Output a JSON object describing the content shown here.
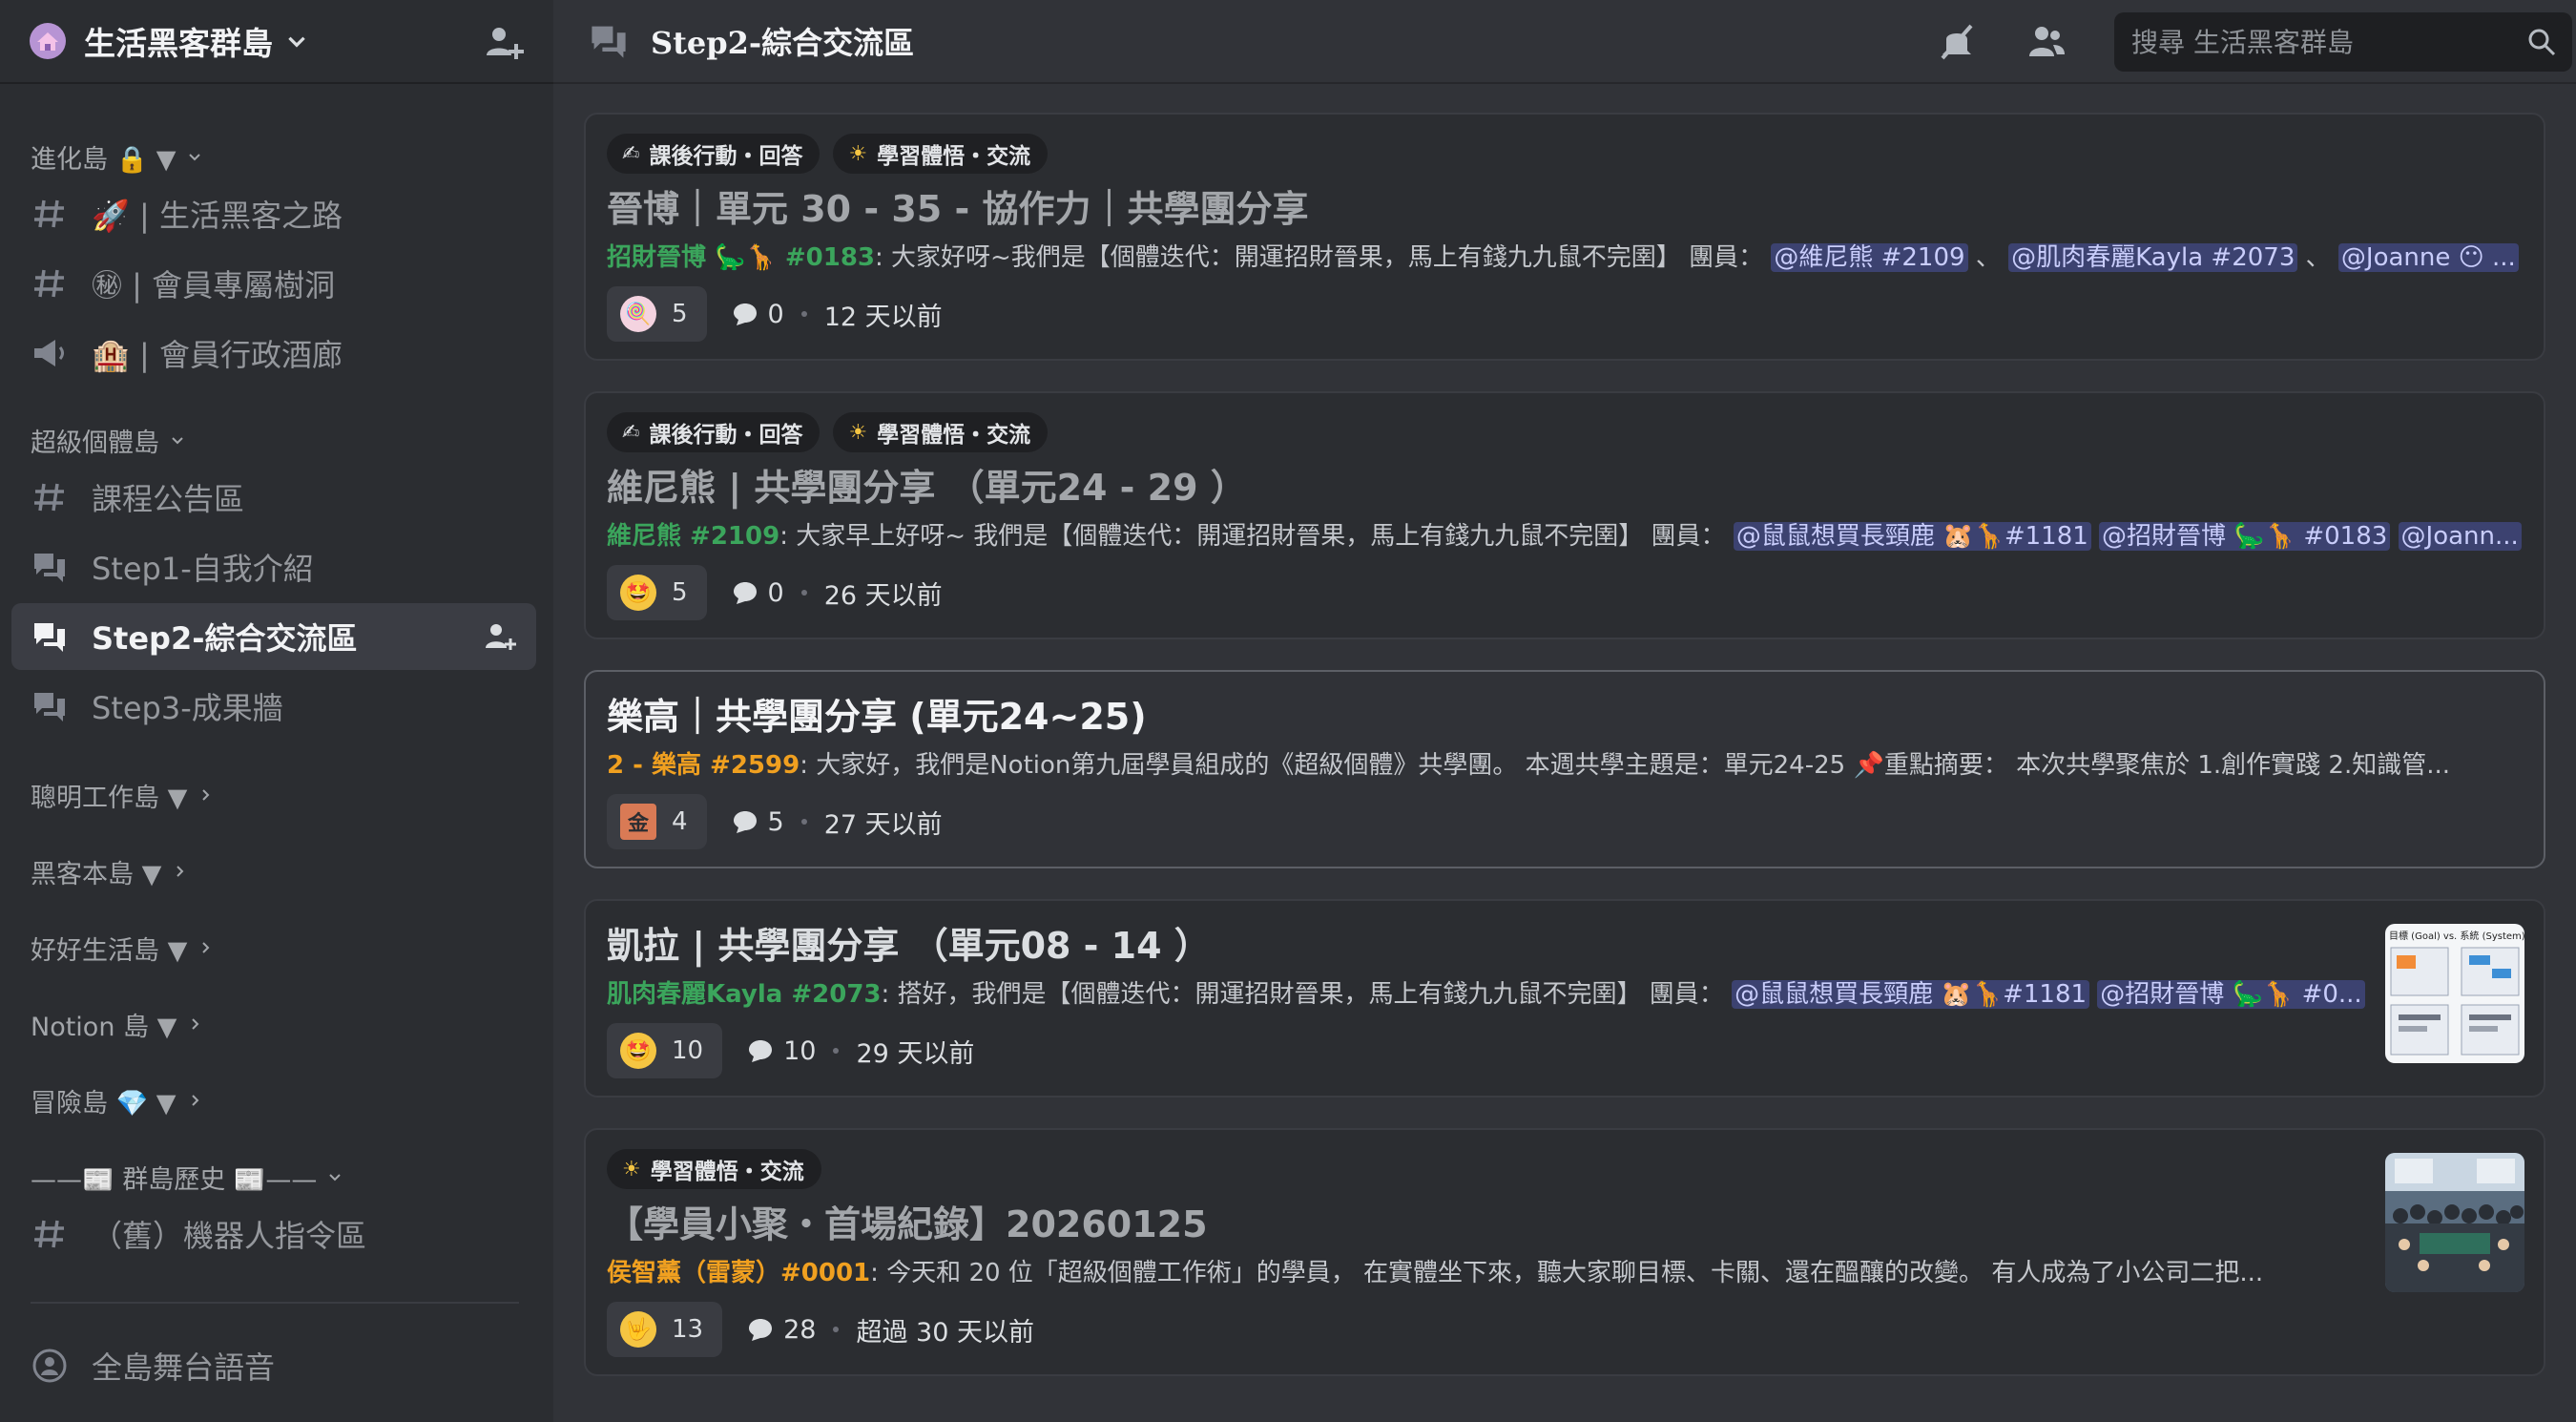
{
  "server": {
    "name": "生活黑客群島"
  },
  "sidebar": {
    "categories": [
      {
        "label": "進化島 🔒 ▼",
        "channels": [
          {
            "label": "🚀 | 生活黑客之路"
          },
          {
            "label": "㊙ | 會員專屬樹洞"
          },
          {
            "label": "🏨 | 會員行政酒廊"
          }
        ]
      },
      {
        "label": "超級個體島",
        "channels": [
          {
            "label": "課程公告區"
          },
          {
            "label": "Step1-自我介紹"
          },
          {
            "label": "Step2-綜合交流區"
          },
          {
            "label": "Step3-成果牆"
          }
        ]
      },
      {
        "label": "聰明工作島 ▼"
      },
      {
        "label": "黑客本島 ▼"
      },
      {
        "label": "好好生活島 ▼"
      },
      {
        "label": "Notion 島 ▼"
      },
      {
        "label": "冒險島 💎 ▼"
      },
      {
        "label": "——📰 群島歷史 📰——",
        "channels": [
          {
            "label": "（舊）機器人指令區"
          }
        ]
      }
    ],
    "bottom_channel": "全島舞台語音"
  },
  "topbar": {
    "title": "Step2-綜合交流區",
    "search_placeholder": "搜尋 生活黑客群島"
  },
  "colors": {
    "accent": "#5865f2",
    "author_green": "#3ba55c",
    "author_orange": "#f0a020",
    "mention_bg": "#3c4270"
  },
  "posts": [
    {
      "tags": [
        {
          "icon": "✍",
          "label": "課後行動・回答"
        },
        {
          "icon": "☀",
          "label": "學習體悟・交流"
        }
      ],
      "title": "晉博｜單元 30 - 35 - 協作力｜共學團分享",
      "author": "招財晉博 🦕🦒 #0183",
      "preview": ": 大家好呀~我們是【個體迭代：開運招財晉果，馬上有錢九九鼠不完圉】 團員：",
      "mentions": [
        "@維尼熊 #2109",
        "@肌肉春麗Kayla #2073",
        "@Joanne 😶 ..."
      ],
      "mention_sep": " 、 ",
      "reaction_emoji": "🍭",
      "reactions": "5",
      "comments": "0",
      "time": "12 天以前"
    },
    {
      "tags": [
        {
          "icon": "✍",
          "label": "課後行動・回答"
        },
        {
          "icon": "☀",
          "label": "學習體悟・交流"
        }
      ],
      "title": "維尼熊 | 共學團分享 （單元24 - 29 ）",
      "author": "維尼熊 #2109",
      "preview": ": 大家早上好呀~ 我們是【個體迭代：開運招財晉果，馬上有錢九九鼠不完圉】 團員：",
      "mentions": [
        "@鼠鼠想買長頸鹿 🐹🦒#1181",
        "@招財晉博 🦕🦒 #0183",
        "@Joann..."
      ],
      "mention_sep": " ",
      "reaction_emoji": "🤩",
      "reactions": "5",
      "comments": "0",
      "time": "26 天以前"
    },
    {
      "title": "樂高｜共學團分享 (單元24~25)",
      "author": "2 - 樂高 #2599",
      "preview": ": 大家好，我們是Notion第九屆學員組成的《超級個體》共學團。 本週共學主題是：單元24-25 📌重點摘要： 本次共學聚焦於 1.創作實踐 2.知識管...",
      "reaction_emoji": "金",
      "reactions": "4",
      "comments": "5",
      "time": "27 天以前"
    },
    {
      "title": "凱拉 | 共學團分享 （單元08 - 14 ）",
      "author": "肌肉春麗Kayla #2073",
      "preview": ": 搭好，我們是【個體迭代：開運招財晉果，馬上有錢九九鼠不完圉】 團員：",
      "mentions": [
        "@鼠鼠想買長頸鹿 🐹🦒#1181",
        "@招財晉博 🦕🦒 #0..."
      ],
      "mention_sep": " ",
      "reaction_emoji": "🤩",
      "reactions": "10",
      "comments": "10",
      "time": "29 天以前",
      "thumb_caption": "目標 (Goal) vs. 系統 (System)"
    },
    {
      "tags": [
        {
          "icon": "☀",
          "label": "學習體悟・交流"
        }
      ],
      "title": "【學員小聚・首場紀錄】20260125",
      "author": "侯智薰（雷蒙）#0001",
      "preview": ": 今天和 20 位「超級個體工作術」的學員， 在實體坐下來，聽大家聊目標、卡關、還在醞釀的改變。 有人成為了小公司二把...",
      "reaction_emoji": "🤟",
      "reactions": "13",
      "comments": "28",
      "time": "超過 30 天以前"
    }
  ]
}
